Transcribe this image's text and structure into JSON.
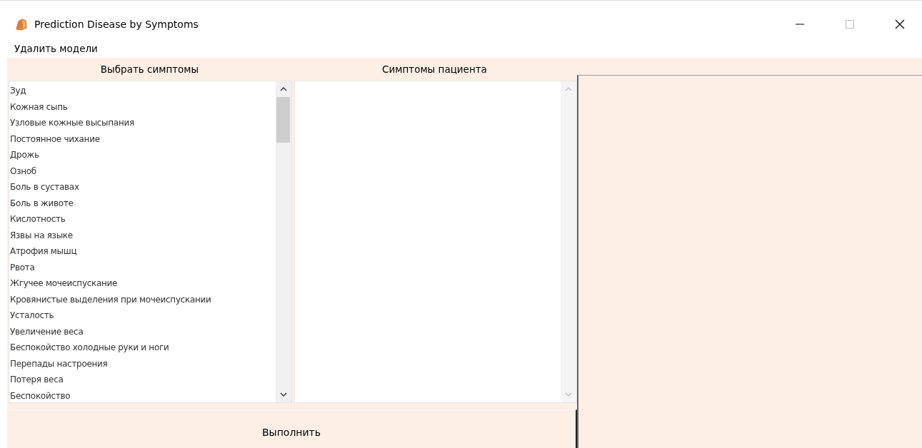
{
  "window": {
    "title": "Prediction Disease by Symptoms"
  },
  "menu": [
    "Удалить модели"
  ],
  "symptoms_header": "Выбрать симптомы",
  "patient_header": "Симптомы пациента",
  "symptoms": [
    "Зуд",
    "Кожная сыпь",
    "Узловые кожные высыпания",
    "Постоянное чихание",
    "Дрожь",
    "Озноб",
    "Боль в суставах",
    "Боль в животе",
    "Кислотность",
    "Язвы на языке",
    "Атрофия мышц",
    "Рвота",
    "Жгучее мочеиспускание",
    "Кровянистые выделения при мочеиспускании",
    "Усталость",
    "Увеличение веса",
    "Беспокойство холодные руки и ноги",
    "Перепады настроения",
    "Потеря веса",
    "Беспокойство"
  ],
  "run_button": "Выполнить"
}
